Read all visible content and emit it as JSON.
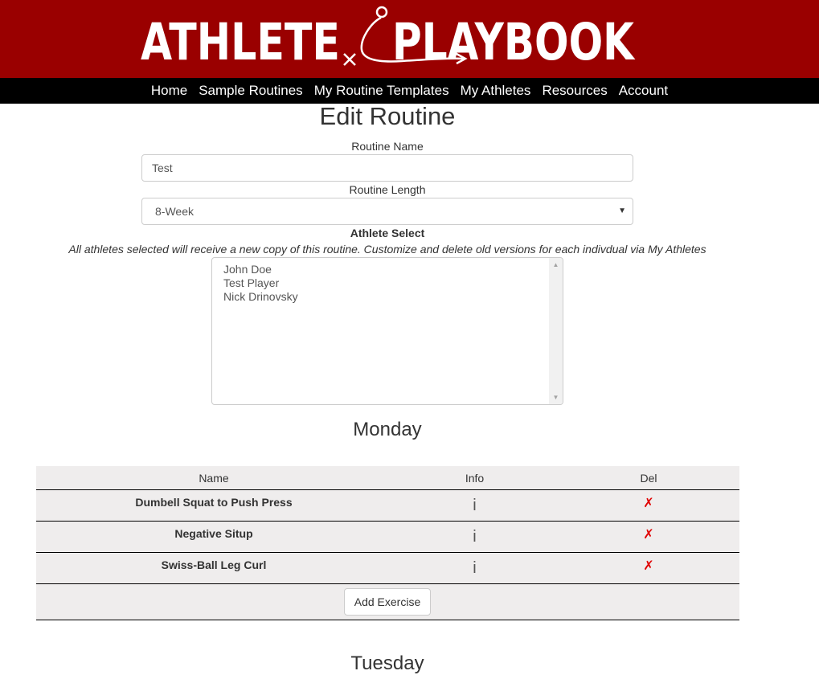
{
  "logo": {
    "word1": "ATHLETE",
    "word2": "PLAYBOOK"
  },
  "nav": {
    "items": [
      {
        "label": "Home"
      },
      {
        "label": "Sample Routines"
      },
      {
        "label": "My Routine Templates"
      },
      {
        "label": "My Athletes"
      },
      {
        "label": "Resources"
      },
      {
        "label": "Account"
      }
    ]
  },
  "page": {
    "title": "Edit Routine"
  },
  "form": {
    "routine_name_label": "Routine Name",
    "routine_name_value": "Test",
    "routine_length_label": "Routine Length",
    "routine_length_value": "8-Week",
    "athlete_select_label": "Athlete Select",
    "athlete_select_note": "All athletes selected will receive a new copy of this routine. Customize and delete old versions for each indivdual via My Athletes",
    "athletes": [
      "John Doe",
      "Test Player",
      "Nick Drinovsky"
    ]
  },
  "days": [
    {
      "title": "Monday",
      "columns": {
        "name": "Name",
        "info": "Info",
        "del": "Del"
      },
      "exercises": [
        {
          "name": "Dumbell Squat to Push Press",
          "info": "i",
          "del": "✗"
        },
        {
          "name": "Negative Situp",
          "info": "i",
          "del": "✗"
        },
        {
          "name": "Swiss-Ball Leg Curl",
          "info": "i",
          "del": "✗"
        }
      ],
      "add_label": "Add Exercise"
    },
    {
      "title": "Tuesday"
    }
  ],
  "colors": {
    "brand_red": "#9a0000",
    "nav_bg": "#000000",
    "delete_red": "#e00000",
    "table_bg": "#efeded"
  }
}
